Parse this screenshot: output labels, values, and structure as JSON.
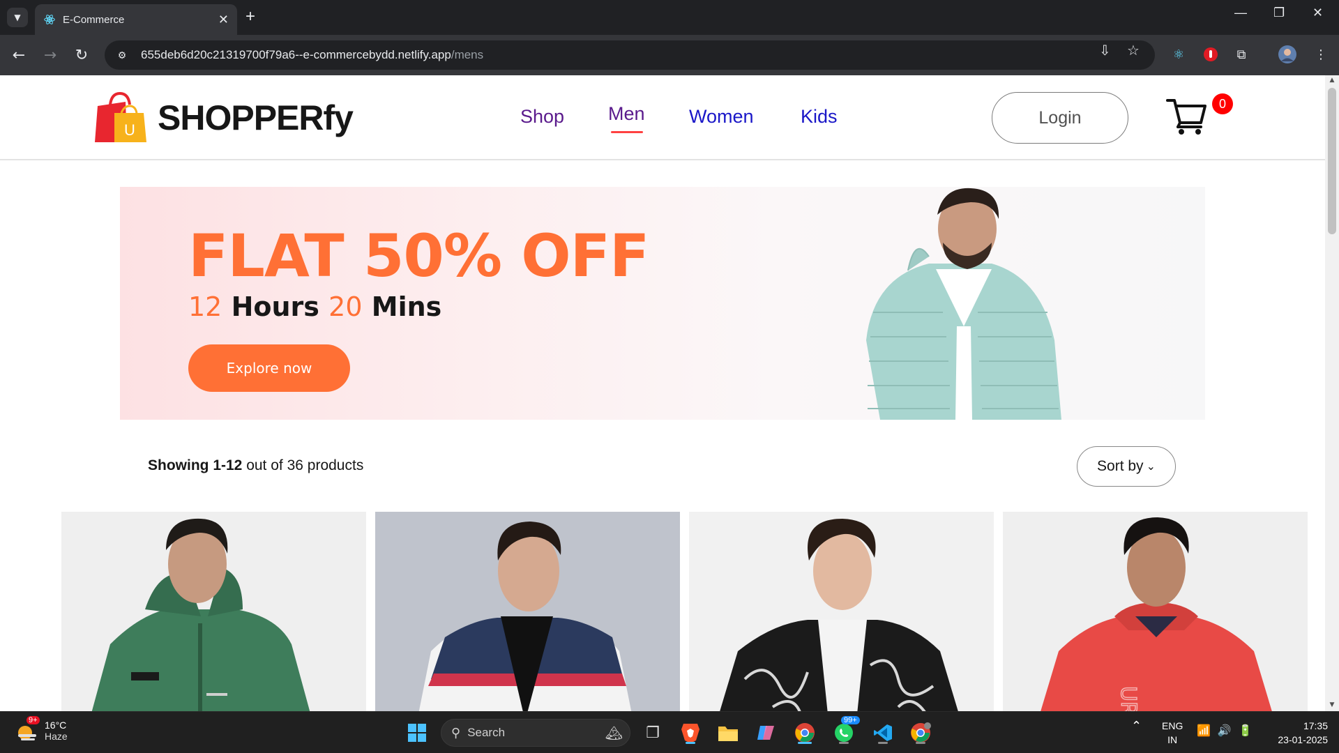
{
  "browser": {
    "tab_title": "E-Commerce",
    "tab_close": "✕",
    "new_tab": "+",
    "url_host": "655deb6d20c21319700f79a6--e-commercebydd.netlify.app",
    "url_path": "/mens"
  },
  "site": {
    "logo_text": "SHOPPERfy",
    "logo_bag_letter": "U",
    "nav": [
      {
        "label": "Shop",
        "color": "#5a1a8c"
      },
      {
        "label": "Men",
        "color": "#5a1a8c",
        "active": true
      },
      {
        "label": "Women",
        "color": "#1a17c8"
      },
      {
        "label": "Kids",
        "color": "#1a17c8"
      }
    ],
    "login_label": "Login",
    "cart_count": "0"
  },
  "banner": {
    "title": "FLAT 50% OFF",
    "hours_num": "12",
    "hours_label": "Hours",
    "mins_num": "20",
    "mins_label": "Mins",
    "cta_label": "Explore now",
    "accent_color": "#ff7035"
  },
  "listing": {
    "showing_bold": "Showing 1-12",
    "showing_rest": "out of 36 products",
    "sort_label": "Sort by"
  },
  "products": [
    {
      "name": "green hoodie jacket",
      "color": "#3d7a5a"
    },
    {
      "name": "navy white colorblock jacket",
      "color": "#2b3a5e"
    },
    {
      "name": "black white printed bomber",
      "color": "#1c1c1c"
    },
    {
      "name": "red windcheater",
      "color": "#e84a46"
    }
  ],
  "taskbar": {
    "weather_temp": "16°C",
    "weather_desc": "Haze",
    "weather_badge": "9+",
    "search_label": "Search",
    "whatsapp_badge": "99+",
    "lang_top": "ENG",
    "lang_bottom": "IN",
    "time": "17:35",
    "date": "23-01-2025"
  }
}
